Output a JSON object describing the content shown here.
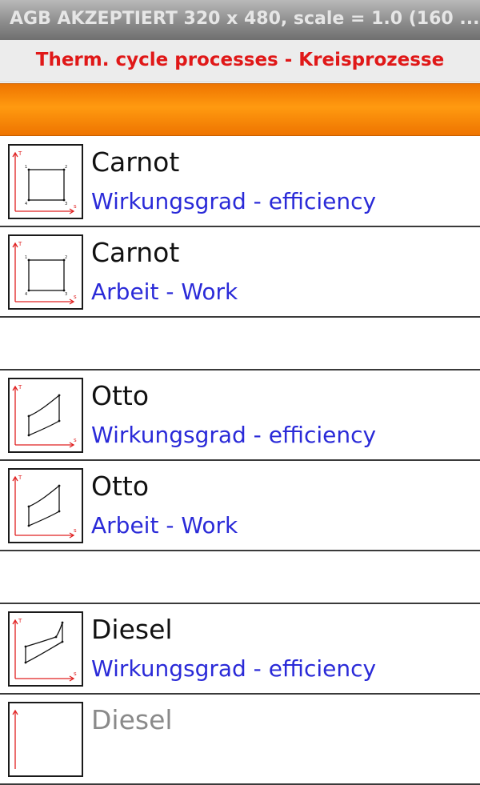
{
  "app": {
    "window_title": "AGB AKZEPTIERT 320 x 480, scale = 1.0 (160 ...",
    "header": "Therm. cycle processes - Kreisprozesse"
  },
  "list": {
    "items": [
      {
        "title": "Carnot",
        "subtitle": "Wirkungsgrad - efficiency",
        "icon": "carnot-diagram-icon"
      },
      {
        "title": "Carnot",
        "subtitle": "Arbeit - Work",
        "icon": "carnot-diagram-icon"
      },
      {
        "title": "Otto",
        "subtitle": "Wirkungsgrad - efficiency",
        "icon": "otto-diagram-icon"
      },
      {
        "title": "Otto",
        "subtitle": "Arbeit - Work",
        "icon": "otto-diagram-icon"
      },
      {
        "title": "Diesel",
        "subtitle": "Wirkungsgrad - efficiency",
        "icon": "diesel-diagram-icon"
      },
      {
        "title": "Diesel",
        "subtitle": "",
        "icon": "diesel-diagram-icon"
      }
    ]
  },
  "colors": {
    "header_text": "#e01818",
    "subtitle_text": "#2a2ad8",
    "orange_bar": "#f58500",
    "axis": "#e02020"
  }
}
